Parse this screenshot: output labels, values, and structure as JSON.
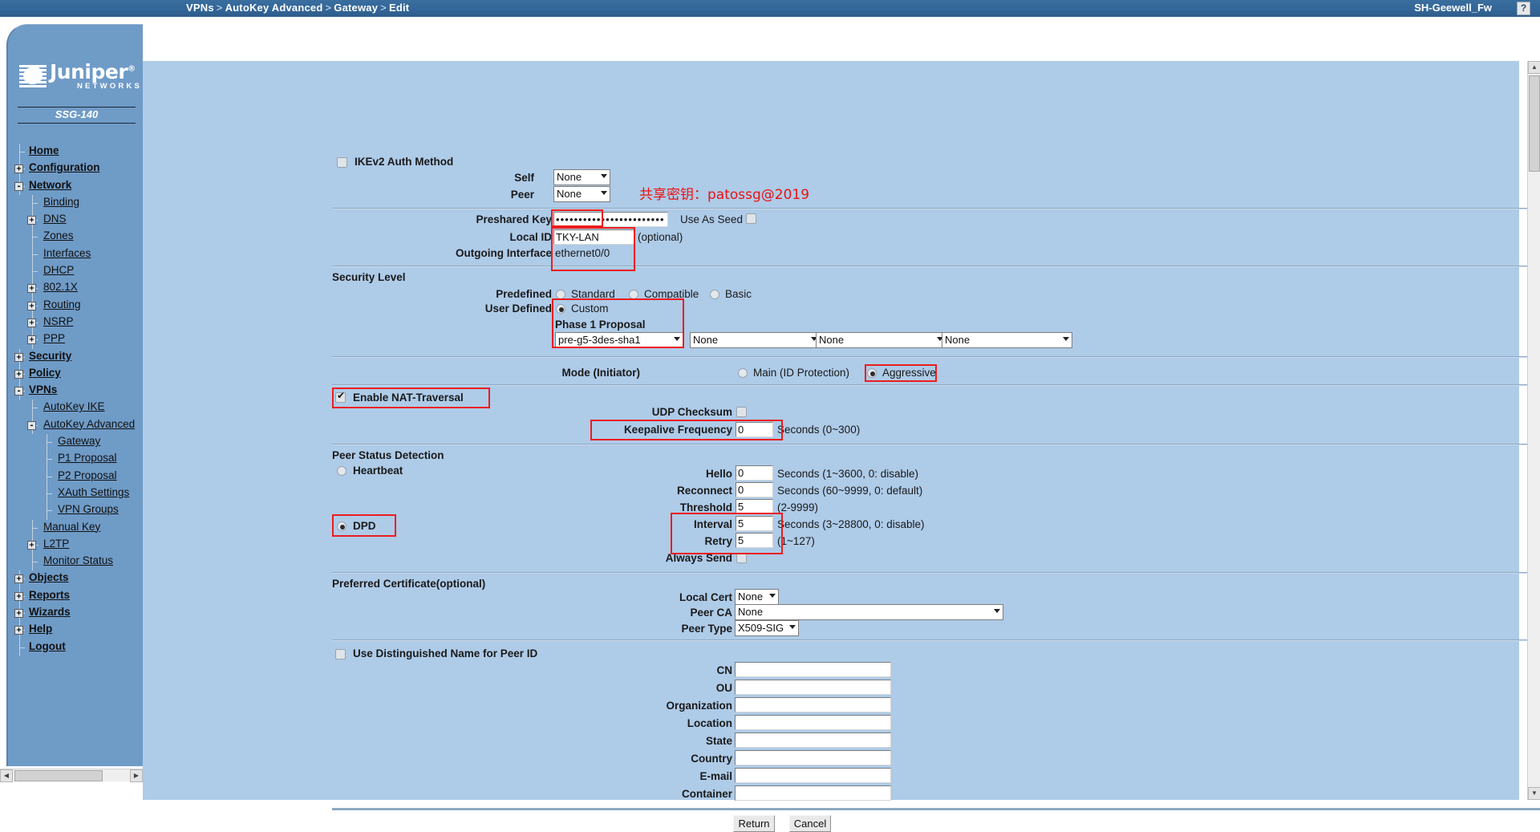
{
  "header": {
    "breadcrumb": [
      "VPNs",
      "AutoKey Advanced",
      "Gateway",
      "Edit"
    ],
    "separator": ">",
    "device_name": "SH-Geewell_Fw",
    "help_label": "?"
  },
  "sidebar": {
    "brand": "Juniper",
    "brand_reg": "®",
    "brand_sub": "NETWORKS",
    "model": "SSG-140",
    "items": [
      {
        "label": "Home",
        "depth": 0,
        "bold": true,
        "toggle": ""
      },
      {
        "label": "Configuration",
        "depth": 0,
        "bold": true,
        "toggle": "+"
      },
      {
        "label": "Network",
        "depth": 0,
        "bold": true,
        "toggle": "-"
      },
      {
        "label": "Binding",
        "depth": 1,
        "bold": false,
        "toggle": ""
      },
      {
        "label": "DNS",
        "depth": 1,
        "bold": false,
        "toggle": "+"
      },
      {
        "label": "Zones",
        "depth": 1,
        "bold": false,
        "toggle": ""
      },
      {
        "label": "Interfaces",
        "depth": 1,
        "bold": false,
        "toggle": ""
      },
      {
        "label": "DHCP",
        "depth": 1,
        "bold": false,
        "toggle": ""
      },
      {
        "label": "802.1X",
        "depth": 1,
        "bold": false,
        "toggle": "+"
      },
      {
        "label": "Routing",
        "depth": 1,
        "bold": false,
        "toggle": "+"
      },
      {
        "label": "NSRP",
        "depth": 1,
        "bold": false,
        "toggle": "+"
      },
      {
        "label": "PPP",
        "depth": 1,
        "bold": false,
        "toggle": "+"
      },
      {
        "label": "Security",
        "depth": 0,
        "bold": true,
        "toggle": "+"
      },
      {
        "label": "Policy",
        "depth": 0,
        "bold": true,
        "toggle": "+"
      },
      {
        "label": "VPNs",
        "depth": 0,
        "bold": true,
        "toggle": "-"
      },
      {
        "label": "AutoKey IKE",
        "depth": 1,
        "bold": false,
        "toggle": ""
      },
      {
        "label": "AutoKey Advanced",
        "depth": 1,
        "bold": false,
        "toggle": "-"
      },
      {
        "label": "Gateway",
        "depth": 2,
        "bold": false,
        "toggle": ""
      },
      {
        "label": "P1 Proposal",
        "depth": 2,
        "bold": false,
        "toggle": ""
      },
      {
        "label": "P2 Proposal",
        "depth": 2,
        "bold": false,
        "toggle": ""
      },
      {
        "label": "XAuth Settings",
        "depth": 2,
        "bold": false,
        "toggle": ""
      },
      {
        "label": "VPN Groups",
        "depth": 2,
        "bold": false,
        "toggle": ""
      },
      {
        "label": "Manual Key",
        "depth": 1,
        "bold": false,
        "toggle": ""
      },
      {
        "label": "L2TP",
        "depth": 1,
        "bold": false,
        "toggle": "+"
      },
      {
        "label": "Monitor Status",
        "depth": 1,
        "bold": false,
        "toggle": ""
      },
      {
        "label": "Objects",
        "depth": 0,
        "bold": true,
        "toggle": "+"
      },
      {
        "label": "Reports",
        "depth": 0,
        "bold": true,
        "toggle": "+"
      },
      {
        "label": "Wizards",
        "depth": 0,
        "bold": true,
        "toggle": "+"
      },
      {
        "label": "Help",
        "depth": 0,
        "bold": true,
        "toggle": "+"
      },
      {
        "label": "Logout",
        "depth": 0,
        "bold": true,
        "toggle": ""
      }
    ]
  },
  "form": {
    "ikev2": {
      "title": "IKEv2 Auth Method",
      "checked": false,
      "self_label": "Self",
      "self_value": "None",
      "peer_label": "Peer",
      "peer_value": "None"
    },
    "annotation": "共享密钥：patossg@2019",
    "preshared": {
      "label": "Preshared Key",
      "value": "••••••••••••••••••••••••",
      "use_as_seed_label": "Use As Seed",
      "use_as_seed_checked": false
    },
    "local_id": {
      "label": "Local ID",
      "value": "TKY-LAN",
      "hint": "(optional)"
    },
    "outgoing_interface": {
      "label": "Outgoing Interface",
      "value": "ethernet0/0"
    },
    "security_level": {
      "title": "Security Level",
      "predefined_label": "Predefined",
      "predefined_options": [
        "Standard",
        "Compatible",
        "Basic"
      ],
      "predefined_selected": "",
      "user_defined_label": "User Defined",
      "custom_label": "Custom",
      "custom_selected": true,
      "phase1_title": "Phase 1 Proposal",
      "phase1_values": [
        "pre-g5-3des-sha1",
        "None",
        "None",
        "None"
      ]
    },
    "mode": {
      "label": "Mode (Initiator)",
      "options": [
        "Main (ID Protection)",
        "Aggressive"
      ],
      "selected": "Aggressive"
    },
    "nat_traversal": {
      "label": "Enable NAT-Traversal",
      "checked": true,
      "udp_checksum_label": "UDP Checksum",
      "udp_checksum_checked": false,
      "keepalive_label": "Keepalive Frequency",
      "keepalive_value": "0",
      "keepalive_hint": "Seconds (0~300)"
    },
    "peer_status": {
      "title": "Peer Status Detection",
      "heartbeat_label": "Heartbeat",
      "heartbeat_selected": false,
      "dpd_label": "DPD",
      "dpd_selected": true,
      "fields": [
        {
          "label": "Hello",
          "value": "0",
          "hint": "Seconds (1~3600, 0: disable)"
        },
        {
          "label": "Reconnect",
          "value": "0",
          "hint": "Seconds (60~9999, 0: default)"
        },
        {
          "label": "Threshold",
          "value": "5",
          "hint": "(2-9999)"
        },
        {
          "label": "Interval",
          "value": "5",
          "hint": "Seconds (3~28800, 0: disable)"
        },
        {
          "label": "Retry",
          "value": "5",
          "hint": "(1~127)"
        }
      ],
      "always_send_label": "Always Send",
      "always_send_checked": false
    },
    "preferred_cert": {
      "title": "Preferred Certificate(optional)",
      "local_cert_label": "Local Cert",
      "local_cert_value": "None",
      "peer_ca_label": "Peer CA",
      "peer_ca_value": "None",
      "peer_type_label": "Peer Type",
      "peer_type_value": "X509-SIG"
    },
    "dn": {
      "title": "Use Distinguished Name for Peer ID",
      "checked": false,
      "fields": [
        {
          "label": "CN",
          "value": ""
        },
        {
          "label": "OU",
          "value": ""
        },
        {
          "label": "Organization",
          "value": ""
        },
        {
          "label": "Location",
          "value": ""
        },
        {
          "label": "State",
          "value": ""
        },
        {
          "label": "Country",
          "value": ""
        },
        {
          "label": "E-mail",
          "value": ""
        },
        {
          "label": "Container",
          "value": ""
        }
      ]
    },
    "buttons": {
      "return_label": "Return",
      "cancel_label": "Cancel"
    }
  },
  "colors": {
    "header_blue": "#336699",
    "panel_blue": "#aecbe8",
    "nav_blue": "#6f9bc7",
    "highlight_red": "#ee1c1c",
    "annotation_red": "#ee1111"
  }
}
